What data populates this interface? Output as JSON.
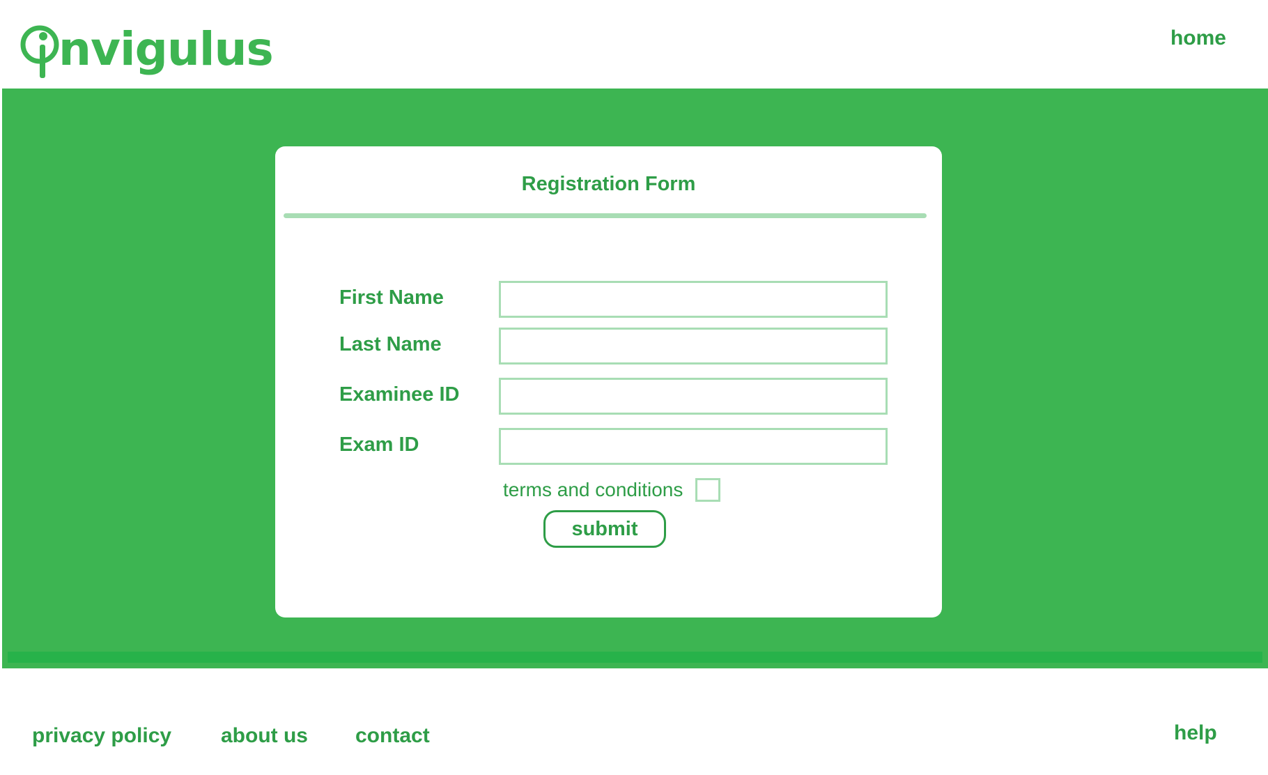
{
  "header": {
    "logo_text": "nvigulus",
    "nav_home": "home"
  },
  "form": {
    "title": "Registration Form",
    "fields": [
      {
        "label": "First Name",
        "value": ""
      },
      {
        "label": "Last Name",
        "value": ""
      },
      {
        "label": "Examinee ID",
        "value": ""
      },
      {
        "label": "Exam ID",
        "value": ""
      }
    ],
    "terms_label": "terms and conditions",
    "terms_checked": false,
    "submit_label": "submit"
  },
  "footer": {
    "privacy": "privacy policy",
    "about": "about us",
    "contact": "contact",
    "help": "help"
  },
  "colors": {
    "brand_green": "#3db552",
    "text_green": "#2e9d47",
    "light_green": "#a8ddb4"
  }
}
